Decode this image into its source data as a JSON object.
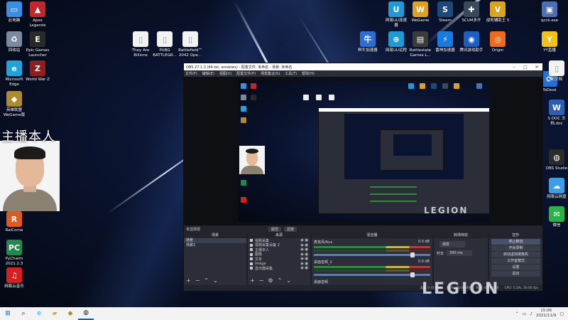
{
  "desktop_icons": [
    {
      "label": "此电脑",
      "icon": "monitor-icon",
      "color": "#3a8ee6",
      "glyph": "▭"
    },
    {
      "label": "回收站",
      "icon": "recycle-bin-icon",
      "color": "#7c8aa0",
      "glyph": "♻"
    },
    {
      "label": "Microsoft\nEdge",
      "icon": "edge-icon",
      "color": "#1fa3d8",
      "glyph": "e"
    },
    {
      "label": "英雄联盟\nWeGame版",
      "icon": "lol-icon",
      "color": "#b08a2e",
      "glyph": "◆"
    },
    {
      "label": "Apex\nLegends",
      "icon": "apex-icon",
      "color": "#c0272d",
      "glyph": "▲"
    },
    {
      "label": "Epic Games\nLauncher",
      "icon": "epic-icon",
      "color": "#2a2a2a",
      "glyph": "E"
    },
    {
      "label": "World War Z",
      "icon": "wwz-icon",
      "color": "#8c1f1f",
      "glyph": "Z"
    },
    {
      "label": "They Are\nBillions",
      "icon": "file-icon",
      "color": "#f2f2f2",
      "glyph": "▯"
    },
    {
      "label": "PUBG\nBATTLEGR...",
      "icon": "file-icon",
      "color": "#f2f2f2",
      "glyph": "▯"
    },
    {
      "label": "Battlefield™\n2042 Ope...",
      "icon": "file-icon",
      "color": "#f2f2f2",
      "glyph": "▯"
    },
    {
      "label": "网易UU加速\n器",
      "icon": "uu-icon",
      "color": "#1e9bd7",
      "glyph": "U"
    },
    {
      "label": "WeGame",
      "icon": "wegame-icon",
      "color": "#e0a020",
      "glyph": "W"
    },
    {
      "label": "Steam",
      "icon": "steam-icon",
      "color": "#1b4a7a",
      "glyph": "S"
    },
    {
      "label": "SCUM多开",
      "icon": "scum-icon",
      "color": "#394a5c",
      "glyph": "✚"
    },
    {
      "label": "战地辅助王 5",
      "icon": "bf-helper-icon",
      "color": "#d9a520",
      "glyph": "V"
    },
    {
      "label": "qcck.exe",
      "icon": "exe-icon",
      "color": "#4a6fb5",
      "glyph": "▣"
    },
    {
      "label": "鲜牛加速器",
      "icon": "xianniu-icon",
      "color": "#2b6fd6",
      "glyph": "牛"
    },
    {
      "label": "网易UU远程",
      "icon": "uu-remote-icon",
      "color": "#1e9bd7",
      "glyph": "⊕"
    },
    {
      "label": "Battlestate\nGames L...",
      "icon": "bsg-icon",
      "color": "#3b3b3b",
      "glyph": "▤"
    },
    {
      "label": "雷神加速器",
      "icon": "leishen-icon",
      "color": "#1a7ae0",
      "glyph": "⚡"
    },
    {
      "label": "腾讯游戏助手",
      "icon": "tencent-icon",
      "color": "#1d5fc0",
      "glyph": "◉"
    },
    {
      "label": "Origin",
      "icon": "origin-icon",
      "color": "#f06a1b",
      "glyph": "◎"
    },
    {
      "label": "YY直播",
      "icon": "yy-icon",
      "color": "#f2c21b",
      "glyph": "Y"
    },
    {
      "label": "ToDesk",
      "icon": "todesk-icon",
      "color": "#2070e0",
      "glyph": "⟳"
    },
    {
      "label": "RaiCorne",
      "icon": "rai-icon",
      "color": "#e05a20",
      "glyph": "R"
    },
    {
      "label": "PyCharm\n2021.2.3",
      "icon": "pycharm-icon",
      "color": "#1f8a4c",
      "glyph": "PC"
    },
    {
      "label": "网易云音乐",
      "icon": "netease-music-icon",
      "color": "#d81e1e",
      "glyph": "♫"
    },
    {
      "label": "新文档",
      "icon": "newdoc-icon",
      "color": "#f2f2f2",
      "glyph": "▯"
    },
    {
      "label": "S DOC 文\n档.doc",
      "icon": "doc-icon",
      "color": "#2b5fb4",
      "glyph": "W"
    },
    {
      "label": "OBS Studio",
      "icon": "obs-icon",
      "color": "#2b2b2b",
      "glyph": "◍"
    },
    {
      "label": "网易云网盘",
      "icon": "netdisk-icon",
      "color": "#3aa0e6",
      "glyph": "☁"
    },
    {
      "label": "微信",
      "icon": "wechat-icon",
      "color": "#2ab24a",
      "glyph": "✉"
    }
  ],
  "webcam": {
    "title": "主播本人"
  },
  "obs": {
    "title": "OBS 27.1.3 (64-bit, windows) - 配置文件: 未命名 - 场景: 未命名",
    "menu": [
      "文件(F)",
      "编辑(E)",
      "视图(V)",
      "配置文件(P)",
      "场景集合(S)",
      "工具(T)",
      "帮助(H)"
    ],
    "dock_bar": {
      "label": "未选择源",
      "props": "属性",
      "filters": "滤镜"
    },
    "scenes": {
      "header": "场景",
      "items": [
        "场景",
        "场景2"
      ]
    },
    "sources": {
      "header": "来源",
      "items": [
        "视频采集",
        "视频采集设备 2",
        "主播本人",
        "图像",
        "文本",
        "image",
        "显示器采集"
      ]
    },
    "mixer": {
      "header": "混音器",
      "channels": [
        {
          "name": "麦克风/Aux",
          "db": "0.0 dB"
        },
        {
          "name": "桌面音频_2",
          "db": "0.0 dB"
        },
        {
          "name": "桌面音频",
          "db": ""
        }
      ]
    },
    "transitions": {
      "header": "转场特效",
      "type": "渐变",
      "duration_label": "时长",
      "duration": "300 ms"
    },
    "controls": {
      "header": "控件",
      "buttons": [
        "停止推流",
        "开始录制",
        "启动虚拟摄像机",
        "工作室模式",
        "设置",
        "退出"
      ]
    },
    "status": {
      "dropped": "丢帧 0 (0.0%)",
      "live": "LIVE: 00:00:00",
      "rec": "REC: 00:00:00",
      "cpu": "CPU: 5.3%, 30.00 fps"
    }
  },
  "brand": {
    "logo_text": "LEGION"
  },
  "taskbar": {
    "time": "15:06",
    "date": "2021/11/9"
  },
  "colors": {
    "accent": "#0a64c8",
    "obs_bg": "#2b2e38",
    "meter_green": "#2e8b3e"
  }
}
